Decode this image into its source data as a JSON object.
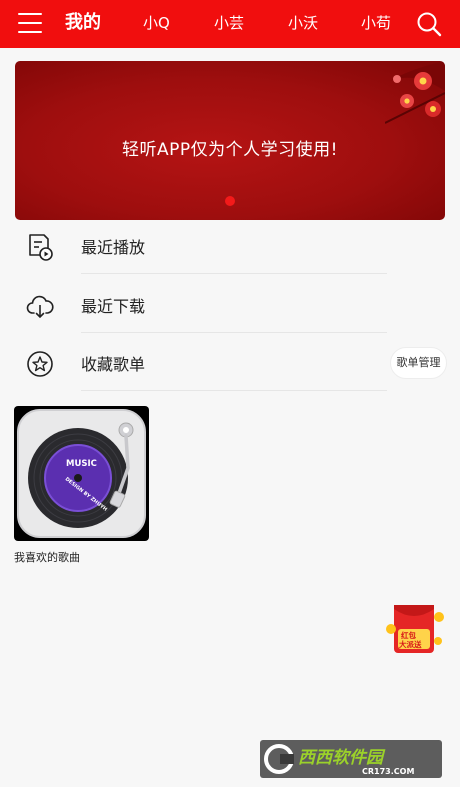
{
  "header": {
    "tabs": [
      {
        "label": "我的",
        "active": true
      },
      {
        "label": "小Q"
      },
      {
        "label": "小芸"
      },
      {
        "label": "小沃"
      },
      {
        "label": "小苟"
      }
    ],
    "accent_color": "#f10e0e"
  },
  "banner": {
    "text": "轻听APP仅为个人学习使用!",
    "slide_count": 1,
    "active_slide": 1
  },
  "menu": {
    "items": [
      {
        "label": "最近播放",
        "icon": "recent-play-icon"
      },
      {
        "label": "最近下载",
        "icon": "cloud-download-icon"
      },
      {
        "label": "收藏歌单",
        "icon": "star-icon"
      }
    ],
    "manage_label": "歌单管理"
  },
  "playlists": [
    {
      "title": "我喜欢的歌曲",
      "cover_lines": [
        "MUSIC",
        "DESIGN BY ZHUYH"
      ]
    }
  ],
  "floating": {
    "red_packet_text": [
      "红包",
      "大派送"
    ]
  },
  "watermark": {
    "text": "西西软件园",
    "url": "CR173.COM"
  }
}
